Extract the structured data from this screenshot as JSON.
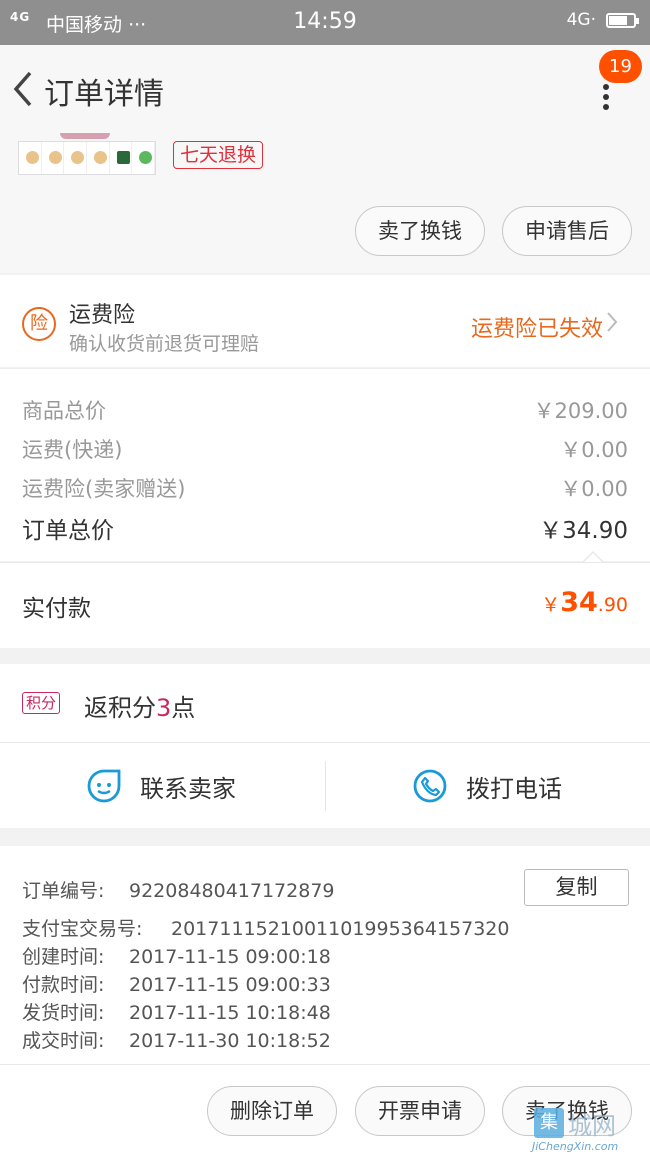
{
  "status_bar": {
    "signal": "4G",
    "carrier": "中国移动",
    "dots": "···",
    "time": "14:59",
    "network": "4G·"
  },
  "nav": {
    "title": "订单详情",
    "badge_count": "19"
  },
  "product": {
    "tag": "七天退换",
    "buttons": [
      "卖了换钱",
      "申请售后"
    ]
  },
  "insurance": {
    "icon_char": "险",
    "title": "运费险",
    "subtitle": "确认收货前退货可理赔",
    "status": "运费险已失效"
  },
  "price": {
    "rows": [
      {
        "label": "商品总价",
        "value": "￥209.00"
      },
      {
        "label": "运费(快递)",
        "value": "￥0.00"
      },
      {
        "label": "运费险(卖家赠送)",
        "value": "￥0.00"
      }
    ],
    "total_label": "订单总价",
    "total_value": "￥34.90",
    "paid_label": "实付款",
    "paid_currency": "￥",
    "paid_int": "34",
    "paid_dec": ".90"
  },
  "points": {
    "tag": "积分",
    "prefix": "返积分",
    "count": "3",
    "suffix": "点"
  },
  "contact": {
    "seller": "联系卖家",
    "call": "拨打电话"
  },
  "order_info": {
    "copy_label": "复制",
    "lines": [
      {
        "key": "订单编号:",
        "value": "92208480417172879"
      },
      {
        "key": "支付宝交易号:",
        "value": "2017111521001101995364157320"
      },
      {
        "key": "创建时间:",
        "value": "2017-11-15 09:00:18"
      },
      {
        "key": "付款时间:",
        "value": "2017-11-15 09:00:33"
      },
      {
        "key": "发货时间:",
        "value": "2017-11-15 10:18:48"
      },
      {
        "key": "成交时间:",
        "value": "2017-11-30 10:18:52"
      }
    ]
  },
  "footer": {
    "buttons": [
      "删除订单",
      "开票申请",
      "卖了换钱"
    ]
  },
  "watermark": {
    "logo_char": "集",
    "name": "城网",
    "url": "JiChengXin.com"
  },
  "colors": {
    "accent": "#ff5000",
    "insurance": "#e8681d",
    "points": "#c8285c",
    "icon_blue": "#1a9ad6"
  }
}
